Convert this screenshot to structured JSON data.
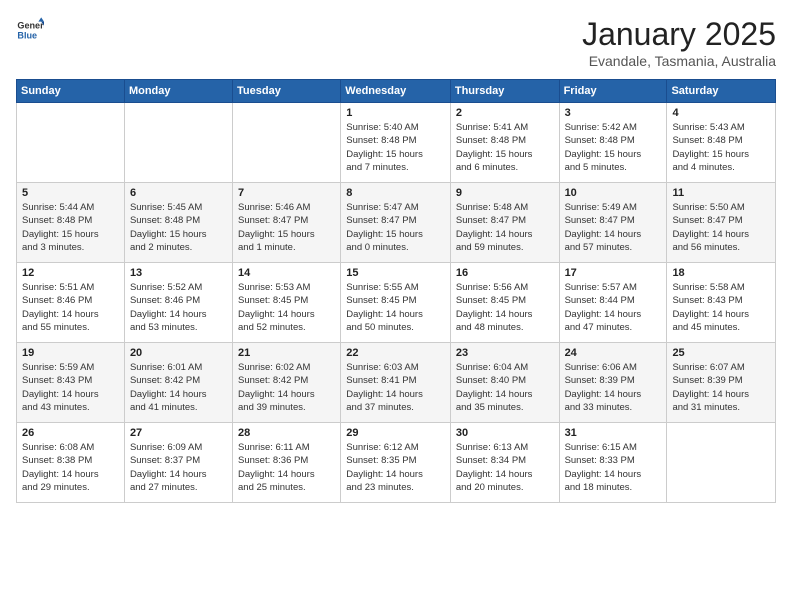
{
  "header": {
    "logo_general": "General",
    "logo_blue": "Blue",
    "title": "January 2025",
    "subtitle": "Evandale, Tasmania, Australia"
  },
  "weekdays": [
    "Sunday",
    "Monday",
    "Tuesday",
    "Wednesday",
    "Thursday",
    "Friday",
    "Saturday"
  ],
  "weeks": [
    [
      {
        "day": "",
        "content": ""
      },
      {
        "day": "",
        "content": ""
      },
      {
        "day": "",
        "content": ""
      },
      {
        "day": "1",
        "content": "Sunrise: 5:40 AM\nSunset: 8:48 PM\nDaylight: 15 hours\nand 7 minutes."
      },
      {
        "day": "2",
        "content": "Sunrise: 5:41 AM\nSunset: 8:48 PM\nDaylight: 15 hours\nand 6 minutes."
      },
      {
        "day": "3",
        "content": "Sunrise: 5:42 AM\nSunset: 8:48 PM\nDaylight: 15 hours\nand 5 minutes."
      },
      {
        "day": "4",
        "content": "Sunrise: 5:43 AM\nSunset: 8:48 PM\nDaylight: 15 hours\nand 4 minutes."
      }
    ],
    [
      {
        "day": "5",
        "content": "Sunrise: 5:44 AM\nSunset: 8:48 PM\nDaylight: 15 hours\nand 3 minutes."
      },
      {
        "day": "6",
        "content": "Sunrise: 5:45 AM\nSunset: 8:48 PM\nDaylight: 15 hours\nand 2 minutes."
      },
      {
        "day": "7",
        "content": "Sunrise: 5:46 AM\nSunset: 8:47 PM\nDaylight: 15 hours\nand 1 minute."
      },
      {
        "day": "8",
        "content": "Sunrise: 5:47 AM\nSunset: 8:47 PM\nDaylight: 15 hours\nand 0 minutes."
      },
      {
        "day": "9",
        "content": "Sunrise: 5:48 AM\nSunset: 8:47 PM\nDaylight: 14 hours\nand 59 minutes."
      },
      {
        "day": "10",
        "content": "Sunrise: 5:49 AM\nSunset: 8:47 PM\nDaylight: 14 hours\nand 57 minutes."
      },
      {
        "day": "11",
        "content": "Sunrise: 5:50 AM\nSunset: 8:47 PM\nDaylight: 14 hours\nand 56 minutes."
      }
    ],
    [
      {
        "day": "12",
        "content": "Sunrise: 5:51 AM\nSunset: 8:46 PM\nDaylight: 14 hours\nand 55 minutes."
      },
      {
        "day": "13",
        "content": "Sunrise: 5:52 AM\nSunset: 8:46 PM\nDaylight: 14 hours\nand 53 minutes."
      },
      {
        "day": "14",
        "content": "Sunrise: 5:53 AM\nSunset: 8:45 PM\nDaylight: 14 hours\nand 52 minutes."
      },
      {
        "day": "15",
        "content": "Sunrise: 5:55 AM\nSunset: 8:45 PM\nDaylight: 14 hours\nand 50 minutes."
      },
      {
        "day": "16",
        "content": "Sunrise: 5:56 AM\nSunset: 8:45 PM\nDaylight: 14 hours\nand 48 minutes."
      },
      {
        "day": "17",
        "content": "Sunrise: 5:57 AM\nSunset: 8:44 PM\nDaylight: 14 hours\nand 47 minutes."
      },
      {
        "day": "18",
        "content": "Sunrise: 5:58 AM\nSunset: 8:43 PM\nDaylight: 14 hours\nand 45 minutes."
      }
    ],
    [
      {
        "day": "19",
        "content": "Sunrise: 5:59 AM\nSunset: 8:43 PM\nDaylight: 14 hours\nand 43 minutes."
      },
      {
        "day": "20",
        "content": "Sunrise: 6:01 AM\nSunset: 8:42 PM\nDaylight: 14 hours\nand 41 minutes."
      },
      {
        "day": "21",
        "content": "Sunrise: 6:02 AM\nSunset: 8:42 PM\nDaylight: 14 hours\nand 39 minutes."
      },
      {
        "day": "22",
        "content": "Sunrise: 6:03 AM\nSunset: 8:41 PM\nDaylight: 14 hours\nand 37 minutes."
      },
      {
        "day": "23",
        "content": "Sunrise: 6:04 AM\nSunset: 8:40 PM\nDaylight: 14 hours\nand 35 minutes."
      },
      {
        "day": "24",
        "content": "Sunrise: 6:06 AM\nSunset: 8:39 PM\nDaylight: 14 hours\nand 33 minutes."
      },
      {
        "day": "25",
        "content": "Sunrise: 6:07 AM\nSunset: 8:39 PM\nDaylight: 14 hours\nand 31 minutes."
      }
    ],
    [
      {
        "day": "26",
        "content": "Sunrise: 6:08 AM\nSunset: 8:38 PM\nDaylight: 14 hours\nand 29 minutes."
      },
      {
        "day": "27",
        "content": "Sunrise: 6:09 AM\nSunset: 8:37 PM\nDaylight: 14 hours\nand 27 minutes."
      },
      {
        "day": "28",
        "content": "Sunrise: 6:11 AM\nSunset: 8:36 PM\nDaylight: 14 hours\nand 25 minutes."
      },
      {
        "day": "29",
        "content": "Sunrise: 6:12 AM\nSunset: 8:35 PM\nDaylight: 14 hours\nand 23 minutes."
      },
      {
        "day": "30",
        "content": "Sunrise: 6:13 AM\nSunset: 8:34 PM\nDaylight: 14 hours\nand 20 minutes."
      },
      {
        "day": "31",
        "content": "Sunrise: 6:15 AM\nSunset: 8:33 PM\nDaylight: 14 hours\nand 18 minutes."
      },
      {
        "day": "",
        "content": ""
      }
    ]
  ]
}
